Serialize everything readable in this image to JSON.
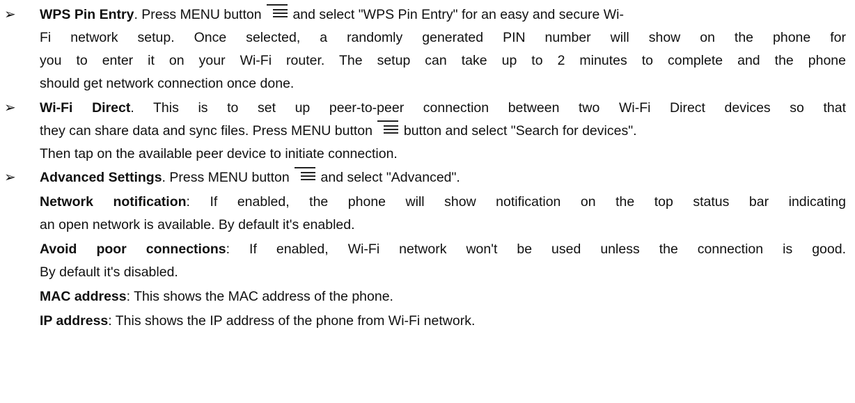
{
  "items": [
    {
      "title": "WPS Pin Entry",
      "lines": [
        {
          "pre": ". Press MENU button",
          "post": "and select \"WPS Pin Entry\" for an easy and secure Wi-"
        },
        {
          "text": "Fi network setup. Once selected, a randomly generated PIN number will show on the phone for"
        },
        {
          "text": "you to enter it on your Wi-Fi router. The setup can take up to 2 minutes to complete and the phone"
        },
        {
          "text": "should get network connection once done."
        }
      ]
    },
    {
      "title": "Wi-Fi Direct",
      "lines": [
        {
          "rest": ". This is to set up peer-to-peer connection between two Wi-Fi Direct devices so that"
        },
        {
          "pre": "they can share data and sync files. Press MENU button",
          "post": "button and select \"Search for devices\"."
        },
        {
          "text": "Then tap on the available peer device to initiate connection."
        }
      ]
    },
    {
      "title": "Advanced Settings",
      "lines": [
        {
          "pre": ". Press MENU button",
          "post": "and select \"Advanced\"."
        }
      ],
      "settings": [
        {
          "term": "Network notification",
          "line1": ": If enabled, the phone will show notification on the top status bar indicating",
          "line2": "an open network is available. By default it's enabled."
        },
        {
          "term": "Avoid poor connections",
          "line1": ": If enabled, Wi-Fi network won't be used unless the connection is good.",
          "line2": "By default it's disabled."
        },
        {
          "term": "MAC address",
          "line1": ": This shows the MAC address of the phone."
        },
        {
          "term": "IP address",
          "line1": ": This shows the IP address of the phone from Wi-Fi network."
        }
      ]
    }
  ],
  "icons": {
    "menu": "menu-icon",
    "bullet": "arrow-bullet-icon"
  },
  "bullet_glyph": "➢"
}
